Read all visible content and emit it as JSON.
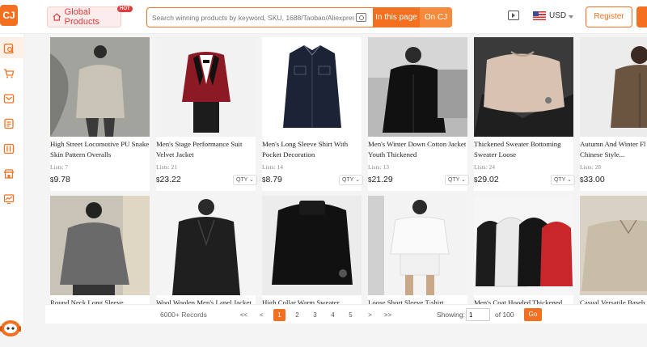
{
  "header": {
    "logo_text": "CJ",
    "global_products_label": "Global Products",
    "hot_badge": "HOT",
    "search_placeholder": "Search winning products by keyword, SKU, 1688/Taobao/Aliexpress ...",
    "in_this_page_label": "In this page",
    "on_cj_label": "On CJ",
    "currency": "USD",
    "register_label": "Register"
  },
  "sidebar": {
    "icons": [
      "search-product-icon",
      "cart-icon",
      "inbox-icon",
      "orders-icon",
      "bookmark-icon",
      "store-icon",
      "analytics-icon",
      "support-bot-icon"
    ]
  },
  "products": [
    {
      "title": "High Street Locomotive PU Snake Skin Pattern Overalls",
      "lists": "Lists: 7",
      "currency": "$",
      "price": "9.78",
      "qty": "QTY"
    },
    {
      "title": "Men's Stage Performance Suit Velvet Jacket",
      "lists": "Lists: 21",
      "currency": "$",
      "price": "23.22",
      "qty": "QTY"
    },
    {
      "title": "Men's Long Sleeve Shirt With Pocket Decoration",
      "lists": "Lists: 14",
      "currency": "$",
      "price": "8.79",
      "qty": "QTY"
    },
    {
      "title": "Men's Winter Down Cotton Jacket Youth Thickened",
      "lists": "Lists: 13",
      "currency": "$",
      "price": "21.29",
      "qty": "QTY"
    },
    {
      "title": "Thickened Sweater Bottoming Sweater Loose",
      "lists": "Lists: 24",
      "currency": "$",
      "price": "29.02",
      "qty": "QTY"
    },
    {
      "title": "Autumn And Winter Fl Vintage Chinese Style...",
      "lists": "Lists: 28",
      "currency": "$",
      "price": "33.00",
      "qty": ""
    },
    {
      "title": "Round Neck Long Sleeve",
      "lists": "",
      "currency": "",
      "price": "",
      "qty": ""
    },
    {
      "title": "Wool Woolen Men's Lapel Jacket",
      "lists": "",
      "currency": "",
      "price": "",
      "qty": ""
    },
    {
      "title": "High Collar Warm Sweater",
      "lists": "",
      "currency": "",
      "price": "",
      "qty": ""
    },
    {
      "title": "Loose Short Sleeve T-shirt",
      "lists": "",
      "currency": "",
      "price": "",
      "qty": ""
    },
    {
      "title": "Men's Coat Hooded Thickened",
      "lists": "",
      "currency": "",
      "price": "",
      "qty": ""
    },
    {
      "title": "Casual Versatile Baseb",
      "lists": "",
      "currency": "",
      "price": "",
      "qty": ""
    }
  ],
  "pagination": {
    "records": "6000+ Records",
    "first": "<<",
    "prev": "<",
    "pages": [
      "1",
      "2",
      "3",
      "4",
      "5"
    ],
    "active_page": "1",
    "next": ">",
    "last": ">>",
    "showing_label": "Showing:",
    "showing_value": "1",
    "of_pages": "of 100",
    "go_label": "Go"
  },
  "colors": {
    "accent": "#f37021"
  }
}
